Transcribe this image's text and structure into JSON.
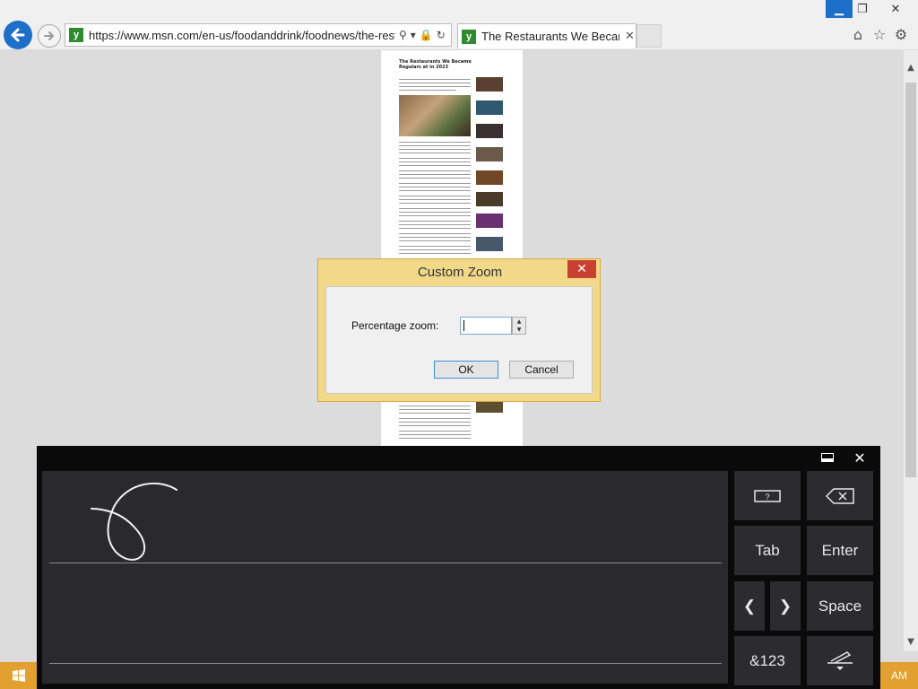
{
  "browser": {
    "url": "https://www.msn.com/en-us/foodanddrink/foodnews/the-resta",
    "tab_title": "The Restaurants We Becam...",
    "close_glyph": "✕"
  },
  "window": {
    "min_glyph": "▁",
    "max_glyph": "❐",
    "close_glyph": "✕"
  },
  "article": {
    "headline": "The Restaurants We Became Regulars at in 2023"
  },
  "dialog": {
    "title": "Custom Zoom",
    "close_glyph": "✕",
    "label": "Percentage zoom:",
    "value": "",
    "ok_label": "OK",
    "cancel_label": "Cancel"
  },
  "keyboard": {
    "close_glyph": "✕",
    "tab_label": "Tab",
    "enter_label": "Enter",
    "space_label": "Space",
    "symbols_label": "&123",
    "left_glyph": "❮",
    "right_glyph": "❯"
  },
  "taskbar": {
    "clock": "AM"
  },
  "colors": {
    "accent": "#1e6fc8",
    "dialog_frame": "#f2d889",
    "close_red": "#c94030",
    "taskbar": "#e2a030"
  }
}
